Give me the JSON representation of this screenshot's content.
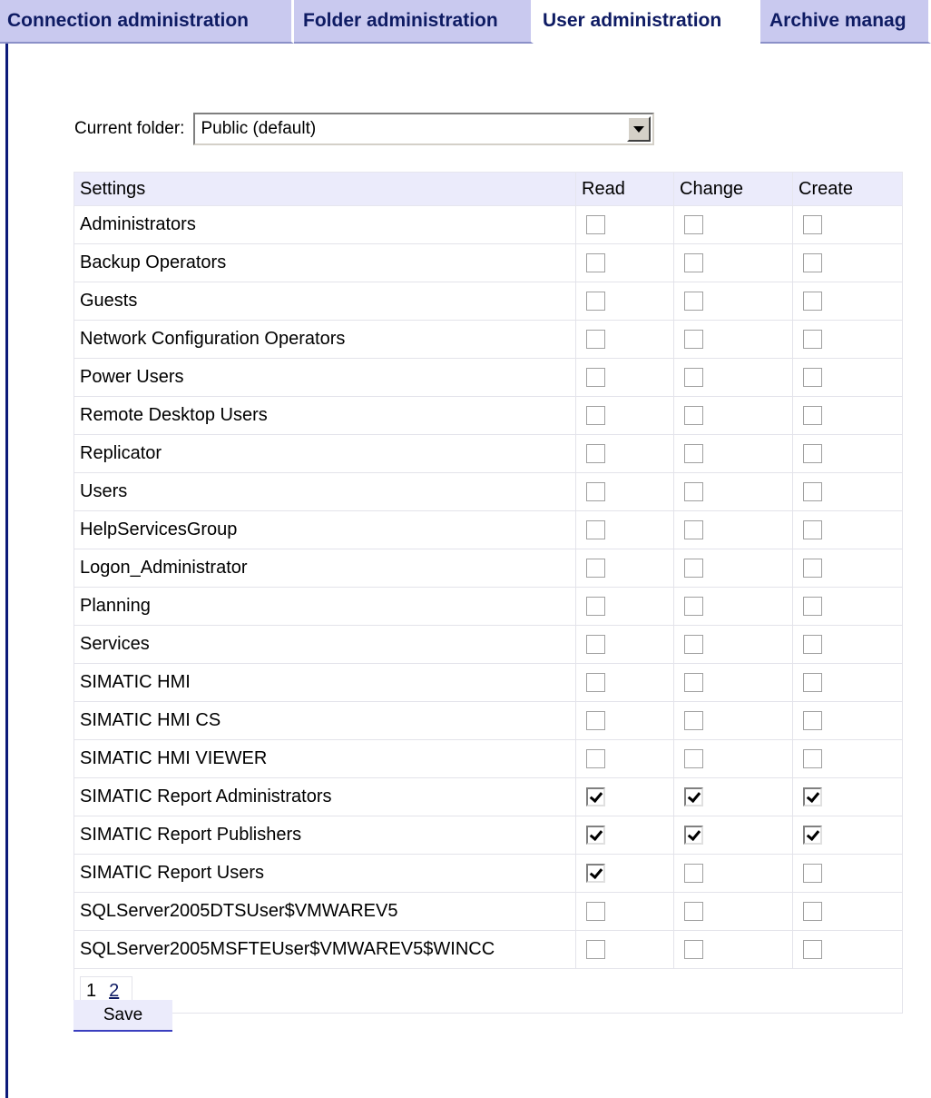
{
  "tabs": [
    {
      "label": "Connection administration",
      "active": false
    },
    {
      "label": "Folder administration",
      "active": false
    },
    {
      "label": "User administration",
      "active": true
    },
    {
      "label": "Archive manag",
      "active": false
    }
  ],
  "folder": {
    "label": "Current folder:",
    "selected": "Public (default)"
  },
  "table": {
    "columns": [
      "Settings",
      "Read",
      "Change",
      "Create"
    ],
    "rows": [
      {
        "name": "Administrators",
        "read": false,
        "change": false,
        "create": false
      },
      {
        "name": "Backup Operators",
        "read": false,
        "change": false,
        "create": false
      },
      {
        "name": "Guests",
        "read": false,
        "change": false,
        "create": false
      },
      {
        "name": "Network Configuration Operators",
        "read": false,
        "change": false,
        "create": false
      },
      {
        "name": "Power Users",
        "read": false,
        "change": false,
        "create": false
      },
      {
        "name": "Remote Desktop Users",
        "read": false,
        "change": false,
        "create": false
      },
      {
        "name": "Replicator",
        "read": false,
        "change": false,
        "create": false
      },
      {
        "name": "Users",
        "read": false,
        "change": false,
        "create": false
      },
      {
        "name": "HelpServicesGroup",
        "read": false,
        "change": false,
        "create": false
      },
      {
        "name": "Logon_Administrator",
        "read": false,
        "change": false,
        "create": false
      },
      {
        "name": "Planning",
        "read": false,
        "change": false,
        "create": false
      },
      {
        "name": "Services",
        "read": false,
        "change": false,
        "create": false
      },
      {
        "name": "SIMATIC HMI",
        "read": false,
        "change": false,
        "create": false
      },
      {
        "name": "SIMATIC HMI CS",
        "read": false,
        "change": false,
        "create": false
      },
      {
        "name": "SIMATIC HMI VIEWER",
        "read": false,
        "change": false,
        "create": false
      },
      {
        "name": "SIMATIC Report Administrators",
        "read": true,
        "change": true,
        "create": true
      },
      {
        "name": "SIMATIC Report Publishers",
        "read": true,
        "change": true,
        "create": true
      },
      {
        "name": "SIMATIC Report Users",
        "read": true,
        "change": false,
        "create": false
      },
      {
        "name": "SQLServer2005DTSUser$VMWAREV5",
        "read": false,
        "change": false,
        "create": false
      },
      {
        "name": "SQLServer2005MSFTEUser$VMWAREV5$WINCC",
        "read": false,
        "change": false,
        "create": false
      }
    ]
  },
  "pager": {
    "current": "1",
    "other": "2"
  },
  "save_label": "Save"
}
